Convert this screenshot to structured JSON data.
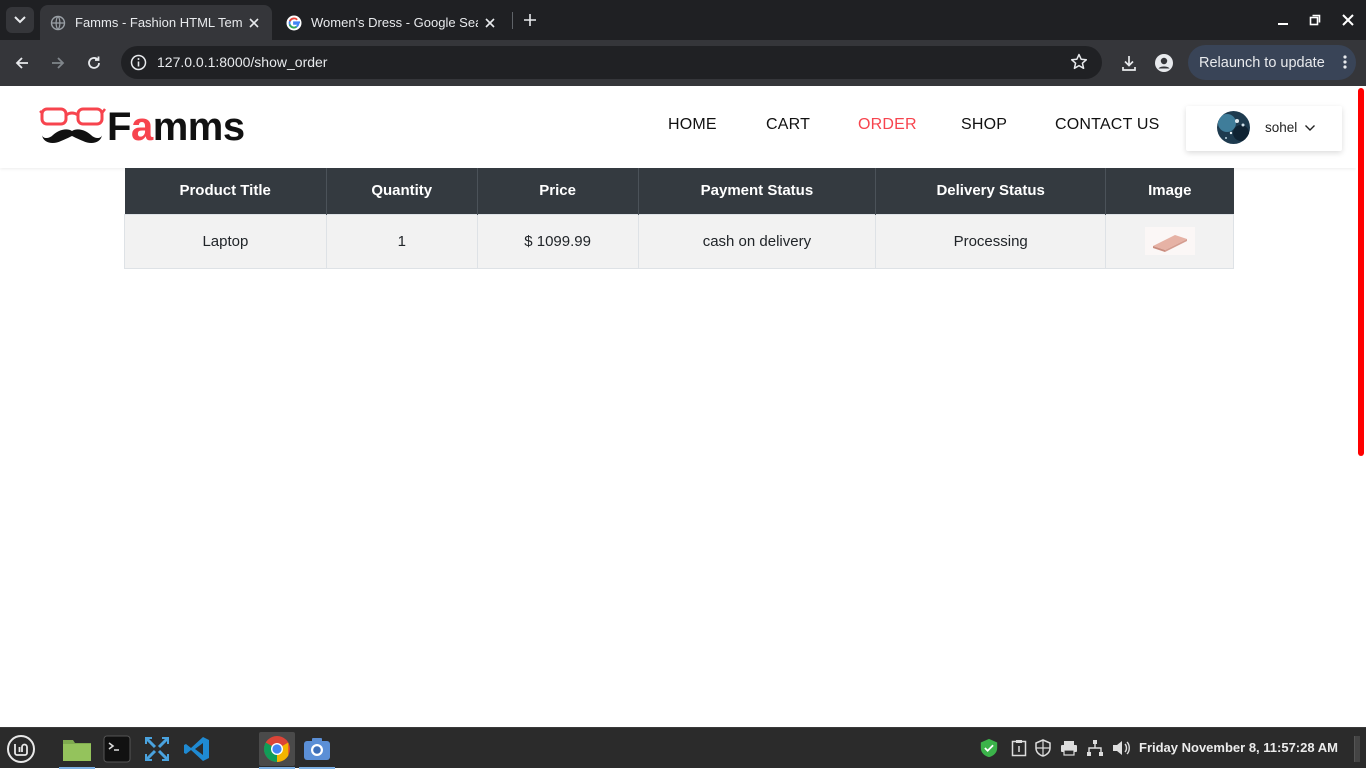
{
  "browser": {
    "tabs": [
      {
        "title": "Famms - Fashion HTML Temp",
        "active": true
      },
      {
        "title": "Women's Dress - Google Sea",
        "active": false
      }
    ],
    "url": "127.0.0.1:8000/show_order",
    "relaunch_label": "Relaunch to update",
    "icons": [
      "tab-search-icon",
      "close-icon",
      "new-tab-icon",
      "minimize-icon",
      "maximize-icon",
      "window-close-icon",
      "back-icon",
      "forward-icon",
      "reload-icon",
      "site-info-icon",
      "bookmark-star-icon",
      "download-icon",
      "profile-icon",
      "menu-dots-icon"
    ]
  },
  "site": {
    "logo": {
      "prefix": "F",
      "accent": "a",
      "suffix": "mms"
    },
    "nav": [
      {
        "label": "HOME",
        "active": false
      },
      {
        "label": "CART",
        "active": false
      },
      {
        "label": "ORDER",
        "active": true
      },
      {
        "label": "SHOP",
        "active": false
      },
      {
        "label": "CONTACT US",
        "active": false
      }
    ],
    "user": {
      "name": "sohel"
    },
    "colors": {
      "accent": "#f7444e",
      "table_header": "#343a40",
      "row_bg": "#f2f2f2"
    }
  },
  "orders": {
    "headers": [
      "Product Title",
      "Quantity",
      "Price",
      "Payment Status",
      "Delivery Status",
      "Image"
    ],
    "rows": [
      {
        "product_title": "Laptop",
        "quantity": "1",
        "price": "$ 1099.99",
        "payment_status": "cash on delivery",
        "delivery_status": "Processing"
      }
    ]
  },
  "taskbar": {
    "apps": [
      "mint-menu-icon",
      "files-icon",
      "terminal-icon",
      "remote-desktop-icon",
      "vscode-icon",
      "chrome-icon",
      "screenshot-icon"
    ],
    "clock": "Friday November  8, 11:57:28 AM"
  }
}
